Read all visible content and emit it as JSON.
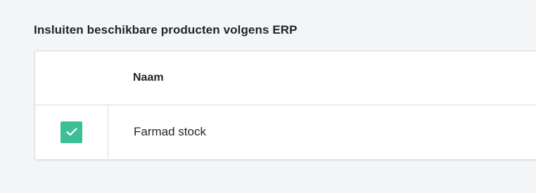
{
  "section": {
    "title": "Insluiten beschikbare producten volgens ERP"
  },
  "table": {
    "columns": [
      "",
      "Naam"
    ],
    "rows": [
      {
        "checked": true,
        "name": "Farmad stock"
      }
    ]
  },
  "icons": {
    "checkbox_check": "check-icon"
  },
  "colors": {
    "accent": "#3dbf96",
    "background": "#f4f5f6"
  }
}
